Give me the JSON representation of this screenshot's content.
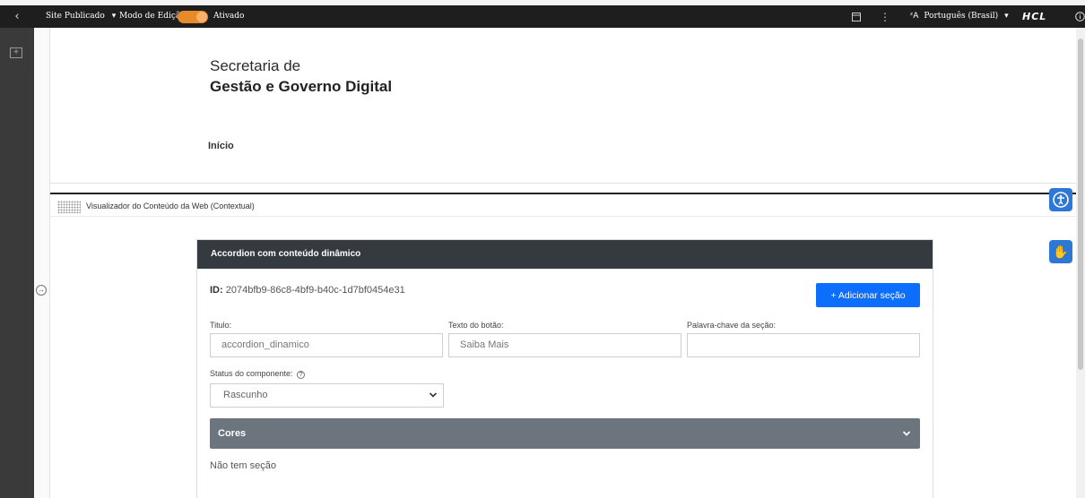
{
  "toolbar": {
    "back_icon": "chevron-left-icon",
    "site_status": "Site Publicado",
    "edit_mode_label": "Modo de Edição:",
    "edit_mode_state": "Ativado",
    "toggle_color": "#e8892a",
    "language": "Português (Brasil)",
    "brand": "HCL"
  },
  "header": {
    "org_line1": "Secretaria de",
    "org_line2": "Gestão e Governo Digital",
    "nav_home": "Início"
  },
  "viewer": {
    "title": "Visualizador do Conteúdo da Web (Contextual)"
  },
  "accordion": {
    "header": "Accordion com conteúdo dinâmico",
    "id_label": "ID:",
    "id_value": "2074bfb9-86c8-4bf9-b40c-1d7bf0454e31",
    "add_section_button": "+ Adicionar seção",
    "fields": {
      "title_label": "Titulo:",
      "title_value": "accordion_dinamico",
      "button_text_label": "Texto do botão:",
      "button_text_value": "Saiba Mais",
      "keyword_label": "Palavra-chave da seção:",
      "keyword_value": "",
      "status_label": "Status do componente:",
      "status_value": "Rascunho"
    },
    "colors_section": "Cores",
    "empty_message": "Não tem seção"
  },
  "colors": {
    "toolbar_bg": "#1e1e1e",
    "accent_blue": "#0d6efd",
    "card_header": "#343a40",
    "section_bar": "#6c757d"
  }
}
